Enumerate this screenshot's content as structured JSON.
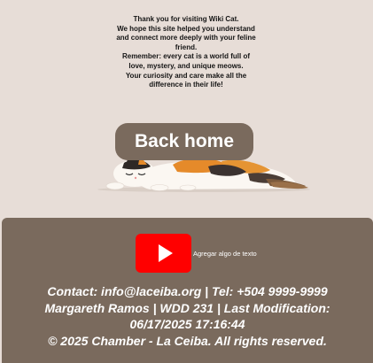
{
  "message": {
    "line1": "Thank you for visiting Wiki Cat.",
    "line2": "We hope this site helped you understand",
    "line3": "and connect more deeply with your feline",
    "line4": "friend.",
    "line5": "Remember: every cat is a world full of",
    "line6": "love, mystery, and unique meows.",
    "line7": "Your curiosity and care make all the",
    "line8": "difference in their life!"
  },
  "back_button": {
    "label": "Back home"
  },
  "footer": {
    "social_label": "Agregar algo de texto",
    "contact": "Contact: info@laceiba.org | Tel: +504 9999-9999",
    "author_line": "Margareth Ramos | WDD 231 | Last Modification:",
    "modified": "06/17/2025 17:16:44",
    "copyright": "© 2025 Chamber - La Ceiba. All rights reserved."
  },
  "icons": {
    "social": "youtube-icon",
    "illustration": "sleeping-calico-cat"
  },
  "colors": {
    "background": "#e7ddd7",
    "accent": "#7a6a5d",
    "youtube": "#ff0000",
    "text_light": "#ffffff"
  }
}
